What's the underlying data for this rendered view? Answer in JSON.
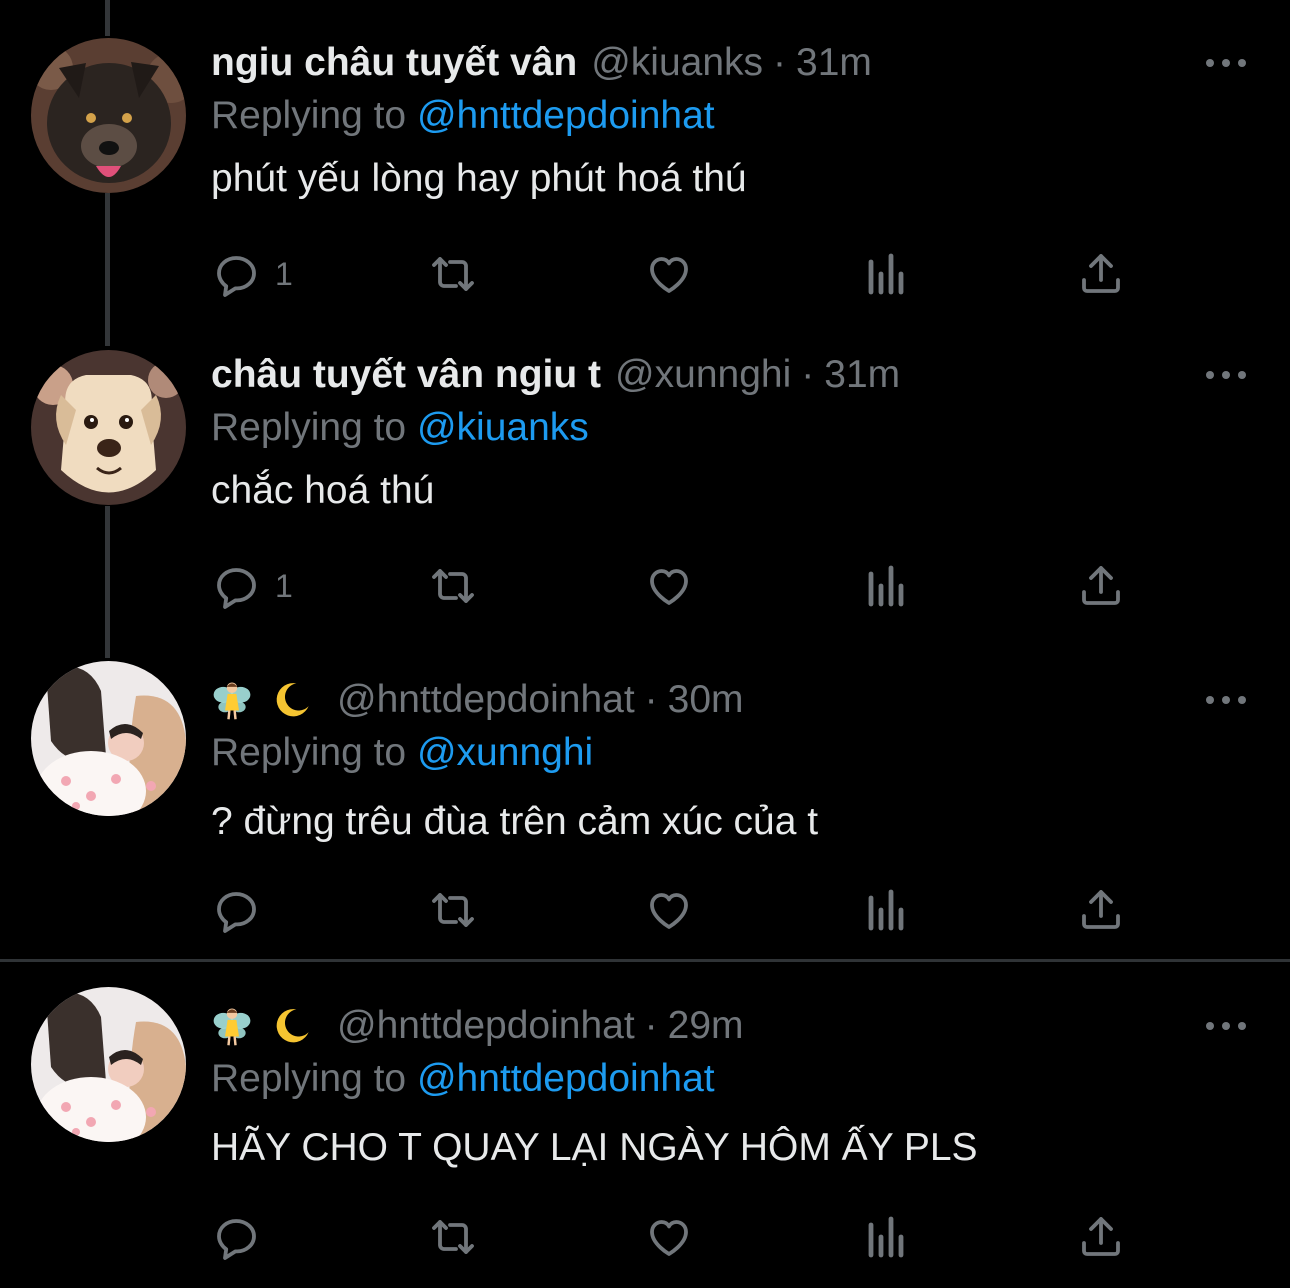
{
  "reply_prefix": "Replying to",
  "tweets": [
    {
      "name": "ngiu châu tuyết vân",
      "handle": "@kiuanks",
      "separator": "·",
      "time": "31m",
      "reply_to": "@hnttdepdoinhat",
      "text": "phút yếu lòng hay phút hoá thú",
      "reply_count": "1",
      "avatar": "dog-dark-avatar"
    },
    {
      "name": "châu tuyết vân ngiu t",
      "handle": "@xunnghi",
      "separator": "·",
      "time": "31m",
      "reply_to": "@kiuanks",
      "text": "chắc hoá thú",
      "reply_count": "1",
      "avatar": "dog-labrador-avatar"
    },
    {
      "name_emojis": [
        "fairy-emoji",
        "crescent-moon-emoji"
      ],
      "handle": "@hnttdepdoinhat",
      "separator": "·",
      "time": "30m",
      "reply_to": "@xunnghi",
      "text": "? đừng trêu đùa trên cảm xúc của t",
      "reply_count": "",
      "avatar": "girls-photo-avatar"
    },
    {
      "name_emojis": [
        "fairy-emoji",
        "crescent-moon-emoji"
      ],
      "handle": "@hnttdepdoinhat",
      "separator": "·",
      "time": "29m",
      "reply_to": "@hnttdepdoinhat",
      "text": "HÃY CHO T QUAY LẠI NGÀY HÔM ẤY PLS",
      "reply_count": "",
      "avatar": "girls-photo-avatar"
    }
  ],
  "icons": [
    "reply-icon",
    "retweet-icon",
    "like-icon",
    "views-icon",
    "share-icon",
    "more-icon"
  ],
  "colors": {
    "background": "#000000",
    "text": "#e7e9ea",
    "muted": "#71767b",
    "link": "#1d9bf0",
    "divider": "#2f3336"
  }
}
